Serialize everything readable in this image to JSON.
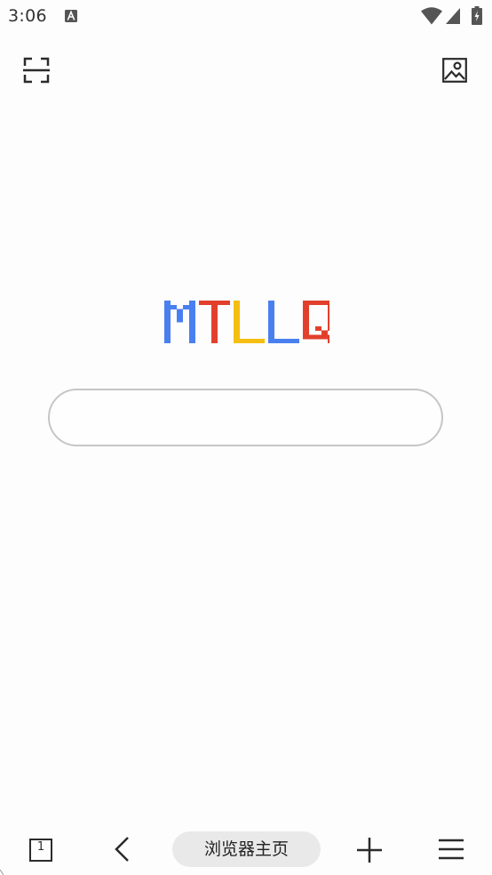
{
  "status_bar": {
    "time": "3:06",
    "notification_icon": "a-square-icon",
    "wifi_icon": "wifi-icon",
    "signal_icon": "signal-icon",
    "battery_icon": "battery-charging-icon"
  },
  "toolbar": {
    "scan_icon": "scan-icon",
    "image_search_icon": "image-icon"
  },
  "logo": {
    "text": "MTLLQ",
    "colors": [
      "#4a7ff0",
      "#e2402c",
      "#f5be12",
      "#4a7ff0",
      "#e2402c"
    ]
  },
  "search": {
    "value": "",
    "placeholder": ""
  },
  "bottom_bar": {
    "tabs_count": "1",
    "home_label": "浏览器主页",
    "back_icon": "chevron-left-icon",
    "new_tab_icon": "plus-icon",
    "menu_icon": "menu-icon"
  }
}
